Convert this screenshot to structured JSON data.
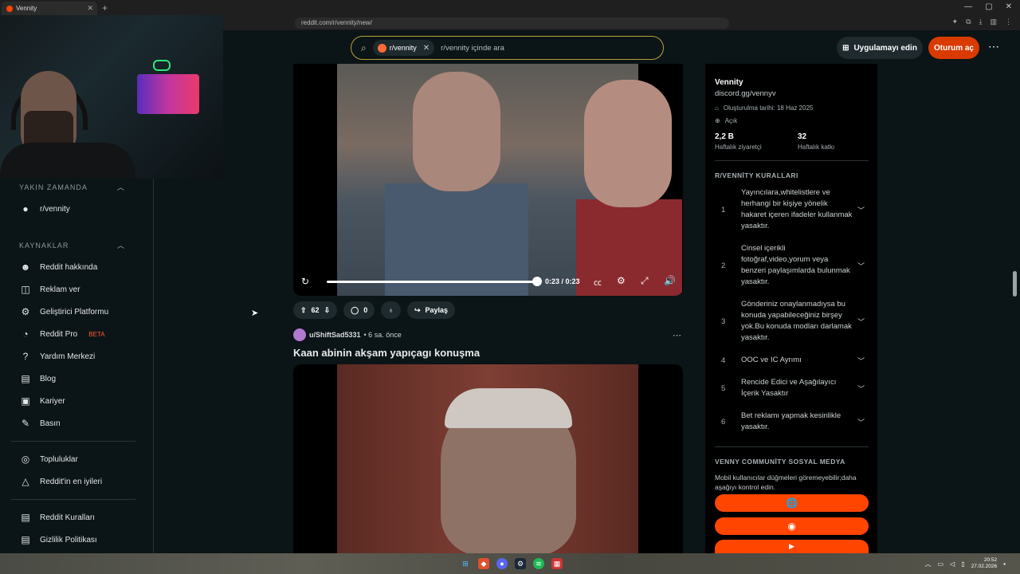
{
  "browser": {
    "tab_title": "Vennity",
    "tab_close": "✕",
    "new_tab": "+",
    "url": "reddit.com/r/vennity/new/",
    "controls": [
      "—",
      "▢",
      "✕"
    ]
  },
  "header": {
    "search_chip": "r/vennity",
    "search_placeholder": "r/vennity içinde ara",
    "app_button": "Uygulamayı edin",
    "login_button": "Oturum aç",
    "more": "⋯"
  },
  "sidebar": {
    "recent_heading": "YAKIN ZAMANDA",
    "recent_items": [
      {
        "label": "r/vennity"
      }
    ],
    "resources_heading": "KAYNAKLAR",
    "resources": [
      {
        "label": "Reddit hakkında",
        "icon": "reddit-icon"
      },
      {
        "label": "Reklam ver",
        "icon": "megaphone-icon"
      },
      {
        "label": "Geliştirici Platformu",
        "icon": "developer-icon"
      },
      {
        "label": "Reddit Pro",
        "icon": "pro-icon",
        "badge": "BETA"
      },
      {
        "label": "Yardım Merkezi",
        "icon": "help-icon"
      },
      {
        "label": "Blog",
        "icon": "book-icon"
      },
      {
        "label": "Kariyer",
        "icon": "briefcase-icon"
      },
      {
        "label": "Basın",
        "icon": "microphone-icon"
      }
    ],
    "community_links": [
      {
        "label": "Topluluklar",
        "icon": "communities-icon"
      },
      {
        "label": "Reddit'in en iyileri",
        "icon": "best-of-icon"
      }
    ],
    "policy_links": [
      {
        "label": "Reddit Kuralları",
        "icon": "rules-book-icon"
      },
      {
        "label": "Gizlilik Politikası",
        "icon": "privacy-book-icon"
      }
    ]
  },
  "video1": {
    "time": "0:23 / 0:23",
    "progress": 1.0
  },
  "post1_actions": {
    "votes": "62",
    "comments": "0",
    "share": "Paylaş"
  },
  "post2": {
    "username": "u/ShiftSad5331",
    "time_ago": "• 6 sa. önce",
    "title": "Kaan abinin akşam yapıçagı konuşma"
  },
  "right_panel": {
    "name": "Vennity",
    "link": "discord.gg/vennyv",
    "created": "Oluşturulma tarihi: 18 Haz 2025",
    "visibility": "Açık",
    "stats": [
      {
        "value": "2,2 B",
        "label": "Haftalık ziyaretçi"
      },
      {
        "value": "32",
        "label": "Haftalık katkı"
      }
    ],
    "rules_heading": "R/VENNİTY KURALLARI",
    "rules": [
      {
        "num": "1",
        "text": "Yayıncılara,whitelistlere ve herhangi bir kişiye yönelik hakaret içeren ifadeler kullanmak yasaktır."
      },
      {
        "num": "2",
        "text": "Cinsel içerikli fotoğraf,video,yorum veya benzeri paylaşımlarda bulunmak yasaktır."
      },
      {
        "num": "3",
        "text": "Gönderiniz onaylanmadıysa bu konuda yapabileceğiniz birşey yok.Bu konuda modları darlamak yasaktır."
      },
      {
        "num": "4",
        "text": "OOC ve IC Ayrımı"
      },
      {
        "num": "5",
        "text": "Rencide Edici ve Aşağılayıcı İçerik Yasaktır"
      },
      {
        "num": "6",
        "text": "Bet reklamı yapmak kesinlikle yasaktır."
      }
    ],
    "social_heading": "VENNY COMMUNİTY SOSYAL MEDYA",
    "social_desc": "Mobil kullanıcılar düğmeleri göremeyebilir;daha aşağıyı kontrol edin.",
    "social_buttons": [
      {
        "icon": "globe-icon",
        "glyph": "🌐"
      },
      {
        "icon": "discord-icon",
        "glyph": "◉"
      },
      {
        "icon": "youtube-icon",
        "glyph": "▶"
      }
    ]
  },
  "taskbar": {
    "time": "20:52",
    "date": "27.02.2026"
  }
}
